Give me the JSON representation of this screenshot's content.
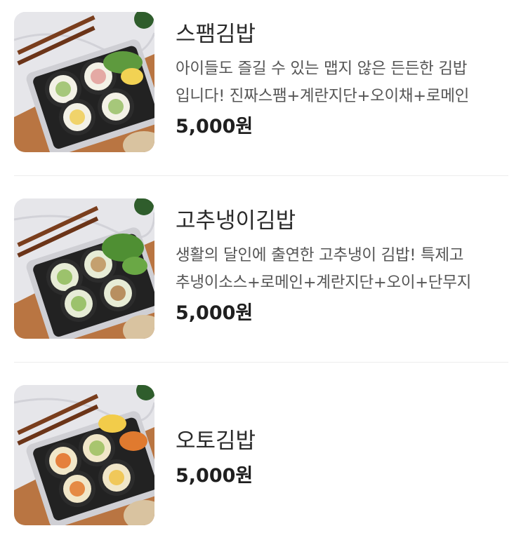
{
  "menu": {
    "items": [
      {
        "name": "스팸김밥",
        "description_lines": [
          "아이들도 즐길 수 있는 맵지 않은 든든한 김밥",
          "입니다! 진짜스팸+계란지단+오이채+로메인"
        ],
        "price": "5,000원",
        "image_icon": "gimbap-photo"
      },
      {
        "name": "고추냉이김밥",
        "description_lines": [
          "생활의 달인에 출연한 고추냉이 김밥! 특제고",
          "추냉이소스+로메인+계란지단+오이+단무지"
        ],
        "price": "5,000원",
        "image_icon": "gimbap-photo"
      },
      {
        "name": "오토김밥",
        "price": "5,000원",
        "image_icon": "gimbap-photo"
      }
    ]
  }
}
